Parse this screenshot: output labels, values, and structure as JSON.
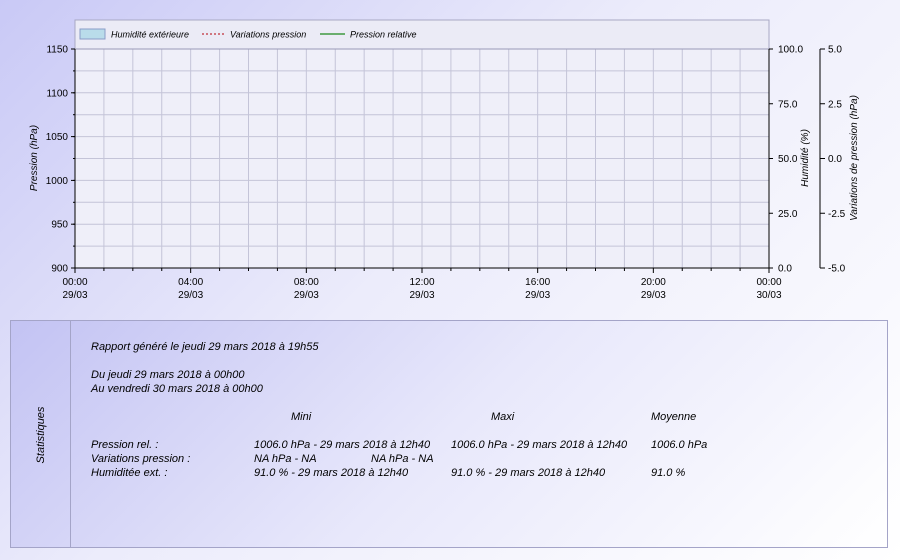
{
  "chart_data": {
    "type": "line",
    "legend": {
      "placement": "top-left",
      "items": [
        {
          "name": "Humidité extérieure",
          "kind": "area",
          "color": "#b9dcea"
        },
        {
          "name": "Variations pression",
          "kind": "dashed-line",
          "color": "#c0303a"
        },
        {
          "name": "Pression relative",
          "kind": "line",
          "color": "#1d8a1d"
        }
      ]
    },
    "x_axis": {
      "ticks": [
        {
          "time": "00:00",
          "date": "29/03"
        },
        {
          "time": "04:00",
          "date": "29/03"
        },
        {
          "time": "08:00",
          "date": "29/03"
        },
        {
          "time": "12:00",
          "date": "29/03"
        },
        {
          "time": "16:00",
          "date": "29/03"
        },
        {
          "time": "20:00",
          "date": "29/03"
        },
        {
          "time": "00:00",
          "date": "30/03"
        }
      ],
      "range": [
        "29/03 00:00",
        "30/03 00:00"
      ],
      "minor_per_major": 4
    },
    "y_left": {
      "label": "Pression (hPa)",
      "min": 900,
      "max": 1150,
      "ticks": [
        "900",
        "950",
        "1000",
        "1050",
        "1100",
        "1150"
      ],
      "minor_step": 25
    },
    "y_right_1": {
      "label": "Humidité (%)",
      "min": 0,
      "max": 100,
      "ticks": [
        "0.0",
        "25.0",
        "50.0",
        "75.0",
        "100.0"
      ]
    },
    "y_right_2": {
      "label": "Variations de pression (hPa)",
      "min": -5,
      "max": 5,
      "ticks": [
        "-5.0",
        "-2.5",
        "0.0",
        "2.5",
        "5.0"
      ]
    },
    "grid": true,
    "series": [
      {
        "name": "Humidité extérieure",
        "axis": "y_right_1",
        "values": []
      },
      {
        "name": "Variations pression",
        "axis": "y_right_2",
        "values": []
      },
      {
        "name": "Pression relative",
        "axis": "y_left",
        "values": []
      }
    ],
    "colors": {
      "plot_bg": "#efeff9",
      "grid": "#c4c4d8",
      "axis": "#000000",
      "legend_bg": "#ebebf6"
    }
  },
  "stats": {
    "side_label": "Statistiques",
    "report_line": "Rapport généré le jeudi 29 mars 2018 à 19h55",
    "from_line": "Du jeudi 29 mars 2018 à 00h00",
    "to_line": "Au vendredi 30 mars 2018 à 00h00",
    "headers": {
      "mini": "Mini",
      "maxi": "Maxi",
      "moyenne": "Moyenne"
    },
    "rows": [
      {
        "label": "Pression rel. :",
        "mini": "1006.0 hPa - 29 mars 2018 à 12h40",
        "maxi": "1006.0 hPa - 29 mars 2018 à 12h40",
        "moyenne": "1006.0 hPa"
      },
      {
        "label": "Variations pression :",
        "mini": "NA hPa - NA",
        "maxi": "NA hPa - NA",
        "moyenne": ""
      },
      {
        "label": "Humiditée ext. :",
        "mini": "91.0 % - 29 mars 2018 à 12h40",
        "maxi": "91.0 % - 29 mars 2018 à 12h40",
        "moyenne": "91.0 %"
      }
    ]
  }
}
